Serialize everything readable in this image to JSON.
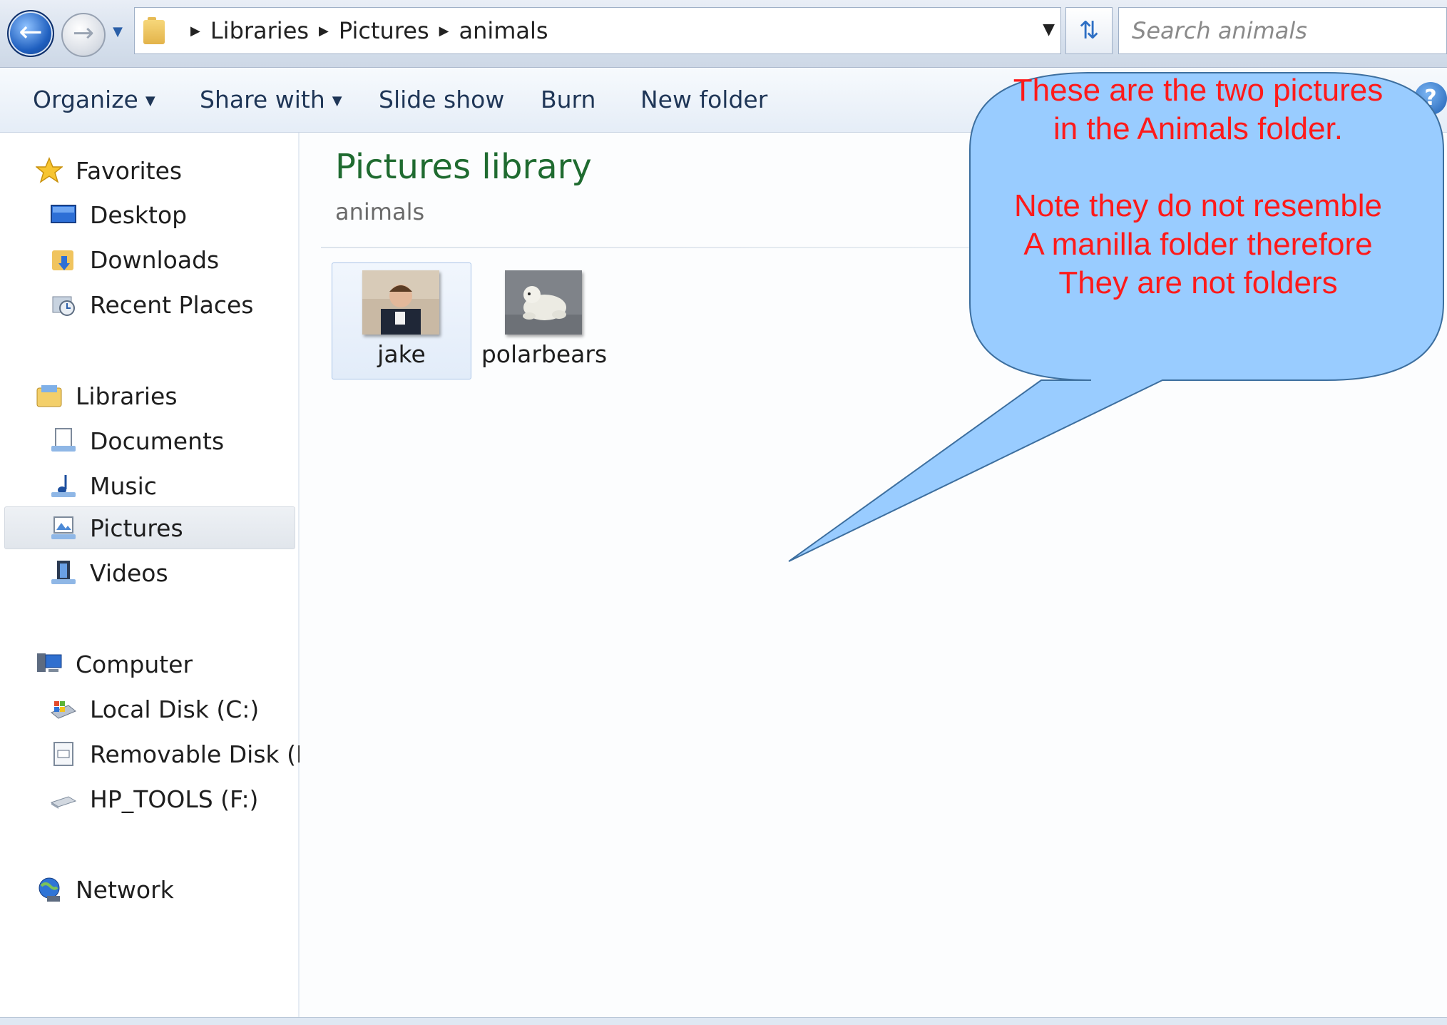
{
  "address_bar": {
    "path": [
      "Libraries",
      "Pictures",
      "animals"
    ],
    "search_placeholder": "Search animals"
  },
  "toolbar": {
    "items": [
      "Organize",
      "Share with",
      "Slide show",
      "Burn",
      "New folder"
    ]
  },
  "sidebar": {
    "favorites": {
      "label": "Favorites",
      "items": [
        "Desktop",
        "Downloads",
        "Recent Places"
      ]
    },
    "libraries": {
      "label": "Libraries",
      "items": [
        "Documents",
        "Music",
        "Pictures",
        "Videos"
      ],
      "selected": "Pictures"
    },
    "computer": {
      "label": "Computer",
      "items": [
        "Local Disk (C:)",
        "Removable Disk (D:)",
        "HP_TOOLS (F:)"
      ]
    },
    "network": {
      "label": "Network"
    }
  },
  "content": {
    "title": "Pictures library",
    "subtitle": "animals",
    "files": [
      {
        "name": "jake",
        "selected": true
      },
      {
        "name": "polarbears",
        "selected": false
      }
    ]
  },
  "callout": {
    "lines": [
      "These are the two pictures",
      "in the Animals folder.",
      "",
      "Note they do not resemble",
      "A manilla folder therefore",
      "They are not folders"
    ],
    "text_color": "#ff1a1a",
    "fill_color": "#99ccff"
  }
}
